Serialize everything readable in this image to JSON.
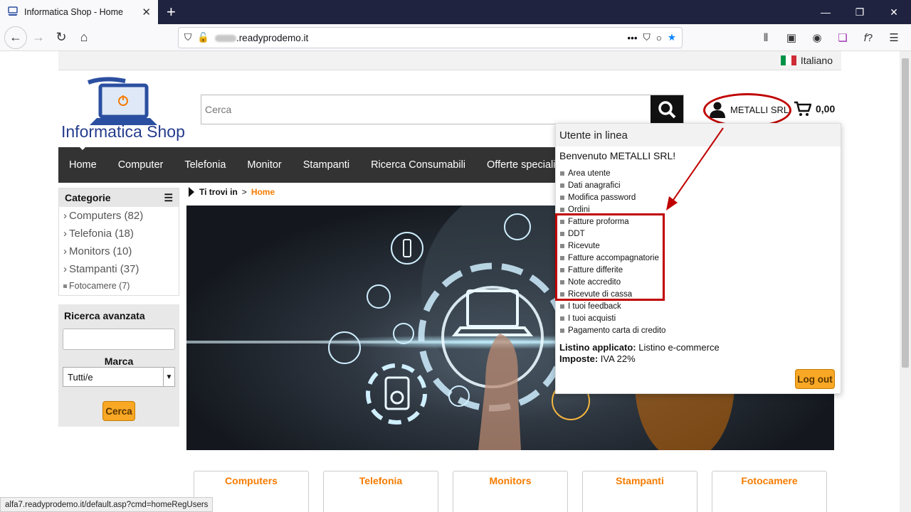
{
  "browser": {
    "tab_title": "Informatica Shop - Home",
    "url_host": ".readyprodemo.it",
    "status_url": "alfa7.readyprodemo.it/default.asp?cmd=homeRegUsers"
  },
  "header": {
    "language": "Italiano",
    "logo_text": "Informatica Shop",
    "search_placeholder": "Cerca",
    "user_name": "METALLI SRL",
    "cart_total": "0,00"
  },
  "menu": {
    "items": [
      "Home",
      "Computer",
      "Telefonia",
      "Monitor",
      "Stampanti",
      "Ricerca Consumabili",
      "Offerte speciali"
    ]
  },
  "sidebar": {
    "categories_title": "Categorie",
    "categories": [
      "Computers (82)",
      "Telefonia (18)",
      "Monitors (10)",
      "Stampanti (37)",
      "Fotocamere (7)"
    ],
    "advanced_title": "Ricerca avanzata",
    "brand_label": "Marca",
    "brand_selected": "Tutti/e",
    "search_button": "Cerca"
  },
  "breadcrumb": {
    "prefix": "Ti trovi in",
    "separator": ">",
    "current": "Home"
  },
  "user_dropdown": {
    "title": "Utente in linea",
    "welcome": "Benvenuto METALLI SRL!",
    "items": [
      "Area utente",
      "Dati anagrafici",
      "Modifica password",
      "Ordini",
      "Fatture proforma",
      "DDT",
      "Ricevute",
      "Fatture accompagnatorie",
      "Fatture differite",
      "Note accredito",
      "Ricevute di cassa",
      "I tuoi feedback",
      "I tuoi acquisti",
      "Pagamento carta di credito"
    ],
    "pricelist_label": "Listino applicato:",
    "pricelist_value": "Listino e-commerce",
    "tax_label": "Imposte:",
    "tax_value": "IVA 22%",
    "logout": "Log out"
  },
  "category_cards": [
    "Computers",
    "Telefonia",
    "Monitors",
    "Stampanti",
    "Fotocamere"
  ],
  "colors": {
    "accent_orange": "#f57c00",
    "annotation_red": "#c00000",
    "menu_dark": "#333333"
  }
}
